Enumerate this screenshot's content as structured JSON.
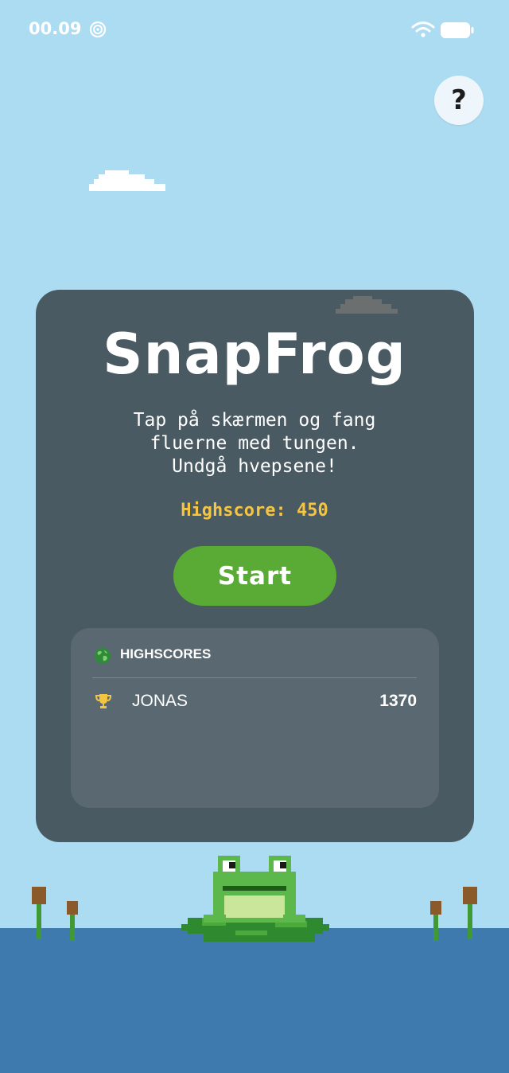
{
  "status_bar": {
    "time": "00.09",
    "icons": [
      "dnd-icon",
      "wifi-icon",
      "battery-icon"
    ]
  },
  "help": {
    "label": "?"
  },
  "game": {
    "title": "SnapFrog",
    "instructions": "Tap på skærmen og fang\nfluerne med tungen.\nUndgå hvepsene!",
    "highscore_text": "Highscore: 450",
    "start_label": "Start"
  },
  "highscores": {
    "title": "HIGHSCORES",
    "icon": "globe-icon",
    "entries": [
      {
        "rank_icon": "trophy-icon",
        "name": "JONAS",
        "score": "1370"
      }
    ]
  },
  "colors": {
    "sky": "#acdcf1",
    "card": "#4a5a63",
    "panel": "#5a6971",
    "accent_green": "#5aab35",
    "highscore_yellow": "#f4c542",
    "water": "#3f7aaf"
  }
}
